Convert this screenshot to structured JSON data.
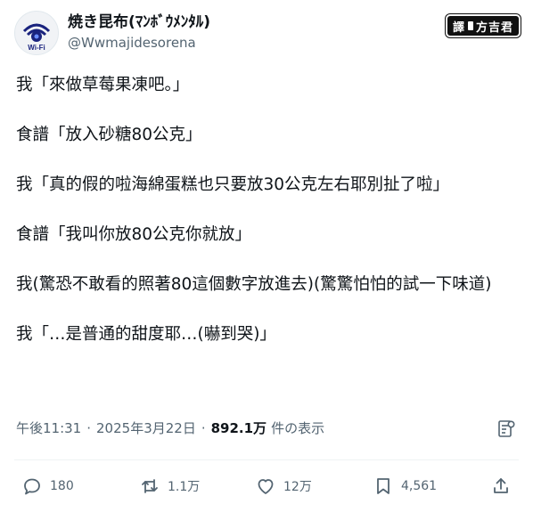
{
  "author": {
    "display_name": "焼き昆布(ﾏﾝﾎﾞｳﾒﾝﾀﾙ)",
    "handle": "@Wwmajidesorena",
    "avatar_label": "Wi-Fi"
  },
  "badge": {
    "left": "譯",
    "right": "方吉君"
  },
  "tweet_lines": [
    "我「來做草莓果凍吧。」",
    "食譜「放入砂糖80公克」",
    "我「真的假的啦海綿蛋糕也只要放30公克左右耶別扯了啦」",
    "食譜「我叫你放80公克你就放」",
    "我(驚恐不敢看的照著80這個數字放進去)(驚驚怕怕的試一下味道)",
    "我「…是普通的甜度耶…(嚇到哭)」"
  ],
  "meta": {
    "time": "午後11:31",
    "date": "2025年3月22日",
    "views": "892.1万",
    "views_label": "件の表示"
  },
  "actions": {
    "reply_count": "180",
    "retweet_count": "1.1万",
    "like_count": "12万",
    "bookmark_count": "4,561"
  },
  "icons": {
    "reply": "reply-icon",
    "retweet": "retweet-icon",
    "like": "heart-icon",
    "bookmark": "bookmark-icon",
    "share": "share-icon",
    "analytics": "analytics-icon"
  },
  "colors": {
    "text": "#0f1419",
    "muted": "#536471",
    "divider": "#eff3f4",
    "avatar_blue": "#1a237e"
  }
}
